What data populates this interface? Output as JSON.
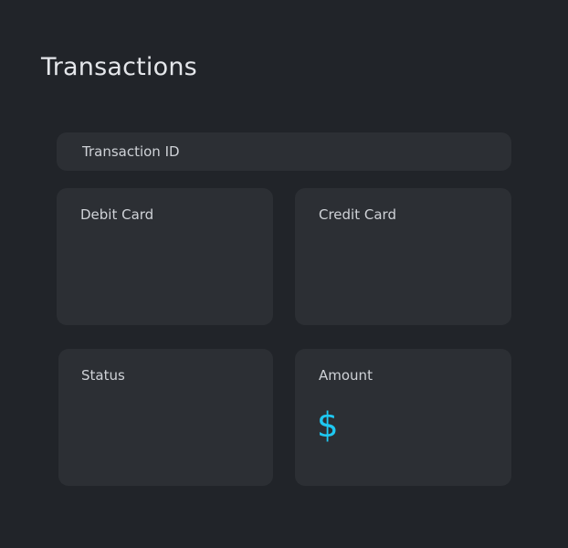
{
  "page": {
    "title": "Transactions"
  },
  "form": {
    "transaction_id_label": "Transaction ID",
    "debit_card_label": "Debit Card",
    "credit_card_label": "Credit Card",
    "status_label": "Status",
    "amount_label": "Amount",
    "currency_symbol": "$"
  },
  "colors": {
    "background": "#212429",
    "card": "#2c2f34",
    "accent": "#1ec8f2",
    "text": "#e4e6ea"
  },
  "icons": {
    "currency": "dollar-icon"
  }
}
